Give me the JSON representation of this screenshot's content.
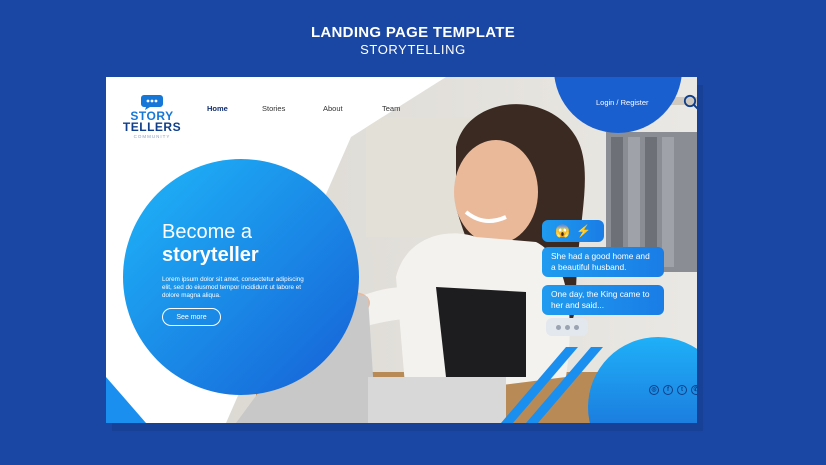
{
  "header": {
    "title": "LANDING PAGE TEMPLATE",
    "subtitle": "STORYTELLING"
  },
  "logo": {
    "line1": "STORY",
    "line2": "TELLERS",
    "tagline": "COMMUNITY"
  },
  "nav": [
    {
      "label": "Home",
      "active": true
    },
    {
      "label": "Stories",
      "active": false
    },
    {
      "label": "About",
      "active": false
    },
    {
      "label": "Team",
      "active": false
    }
  ],
  "auth": {
    "label": "Login / Register"
  },
  "hero": {
    "title_line1": "Become a",
    "title_line2": "storyteller",
    "body": "Lorem ipsum dolor sit amet, consectetur adipiscing elit, sed do eiusmod tempor incididunt ut labore et dolore magna aliqua.",
    "button": "See more"
  },
  "chat": {
    "emoji1": "😱",
    "emoji2": "⚡",
    "message1": "She had a good home and a beautiful husband.",
    "message2": "One day, the King came to her and said..."
  },
  "socials": [
    {
      "icon": "instagram-icon",
      "glyph": "◎"
    },
    {
      "icon": "facebook-icon",
      "glyph": "f"
    },
    {
      "icon": "twitter-icon",
      "glyph": "t"
    },
    {
      "icon": "whatsapp-icon",
      "glyph": "✆"
    }
  ],
  "colors": {
    "background": "#1a47a3",
    "accent": "#1a8ff0",
    "brand_dark": "#0f3f8a"
  }
}
